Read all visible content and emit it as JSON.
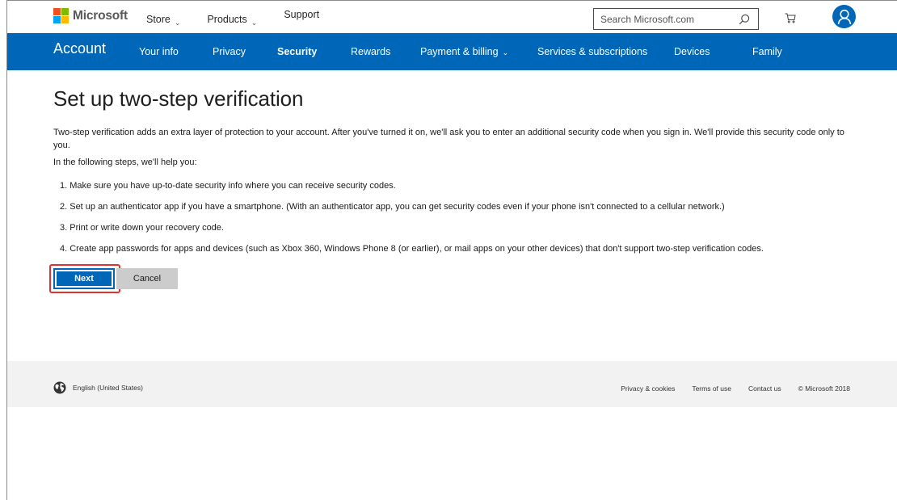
{
  "header": {
    "brand": "Microsoft",
    "nav": [
      {
        "label": "Store",
        "chevron": "⌄"
      },
      {
        "label": "Products",
        "chevron": "⌄"
      },
      {
        "label": "Support"
      }
    ],
    "search_placeholder": "Search Microsoft.com",
    "icons": [
      "search-icon",
      "cart-icon",
      "avatar-icon"
    ]
  },
  "account_nav": {
    "title": "Account",
    "links": [
      {
        "label": "Your info"
      },
      {
        "label": "Privacy"
      },
      {
        "label": "Security",
        "active": true
      },
      {
        "label": "Rewards"
      },
      {
        "label": "Payment & billing",
        "chevron": "⌄"
      },
      {
        "label": "Services & subscriptions"
      },
      {
        "label": "Devices"
      },
      {
        "label": "Family"
      }
    ]
  },
  "main": {
    "title": "Set up two-step verification",
    "intro": "Two-step verification adds an extra layer of protection to your account. After you've turned it on, we'll ask you to enter an additional security code when you sign in. We'll provide this security code only to you.",
    "lead": "In the following steps, we'll help you:",
    "steps": [
      "1. Make sure you have up-to-date security info where you can receive security codes.",
      "2. Set up an authenticator app if you have a smartphone. (With an authenticator app, you can get security codes even if your phone isn't connected to a cellular network.)",
      "3. Print or write down your recovery code.",
      "4. Create app passwords for apps and devices (such as Xbox 360, Windows Phone 8 (or earlier), or mail apps on your other devices) that don't support two-step verification codes."
    ],
    "next_label": "Next",
    "cancel_label": "Cancel"
  },
  "footer": {
    "locale": "English (United States)",
    "links": [
      "Privacy & cookies",
      "Terms of use",
      "Contact us"
    ],
    "copyright": "© Microsoft 2018"
  },
  "colors": {
    "brand_blue": "#0067b8",
    "logo_red": "#f25022",
    "logo_green": "#7fba00",
    "logo_blue": "#00a4ef",
    "logo_yellow": "#ffb900",
    "highlight": "#e03131",
    "footer_bg": "#f2f2f2"
  }
}
